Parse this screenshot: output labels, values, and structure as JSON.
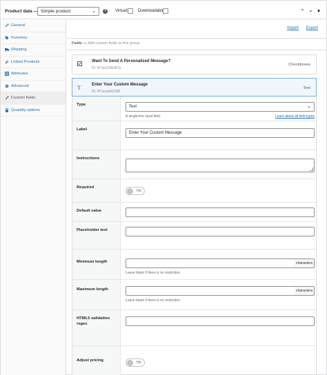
{
  "header": {
    "title": "Product data —",
    "product_type": "Simple product",
    "virtual_label": "Virtual:",
    "downloadable_label": "Downloadable:"
  },
  "sidebar": {
    "items": [
      {
        "label": "General",
        "icon": "wrench-icon"
      },
      {
        "label": "Inventory",
        "icon": "tag-icon"
      },
      {
        "label": "Shipping",
        "icon": "truck-icon"
      },
      {
        "label": "Linked Products",
        "icon": "link-icon"
      },
      {
        "label": "Attributes",
        "icon": "table-icon"
      },
      {
        "label": "Advanced",
        "icon": "gear-icon"
      },
      {
        "label": "Custom fields",
        "icon": "wrench-icon",
        "active": true
      },
      {
        "label": "Quantity options",
        "icon": "calculator-icon"
      }
    ]
  },
  "main": {
    "import_label": "Import",
    "export_label": "Export",
    "fields_label": "Fields —",
    "fields_hint": "Add custom fields to this group.",
    "cards": [
      {
        "title": "Want To Send A Personalized Message?",
        "id": "ID: f47ac629b3815",
        "type": "Checkboxes",
        "icon": "checkbox-icon"
      },
      {
        "title": "Enter Your Custom Message",
        "id": "ID: f47acda66238f",
        "type": "Text",
        "icon": "text-icon"
      }
    ],
    "settings": {
      "type_label": "Type",
      "type_value": "Text",
      "type_help": "A single-line input field.",
      "type_link": "Learn about all field types",
      "label_label": "Label",
      "label_value": "Enter Your Custom Message",
      "instructions_label": "Instructions",
      "required_label": "Required",
      "required_toggle": "No",
      "default_label": "Default value",
      "placeholder_label": "Placeholder text",
      "minlen_label": "Minimum length",
      "minlen_suffix": "characters",
      "minlen_help": "Leave blank if there is no restriction.",
      "maxlen_label": "Maximum length",
      "maxlen_suffix": "characters",
      "maxlen_help": "Leave blank if there is no restriction.",
      "regex_label": "HTML5 validation regex",
      "pricing_label": "Adjust pricing",
      "pricing_toggle": "No"
    }
  },
  "colors": {
    "link": "#2271b1",
    "selected_card_bg": "#f0f6fc",
    "selected_card_border": "#72aee6"
  }
}
